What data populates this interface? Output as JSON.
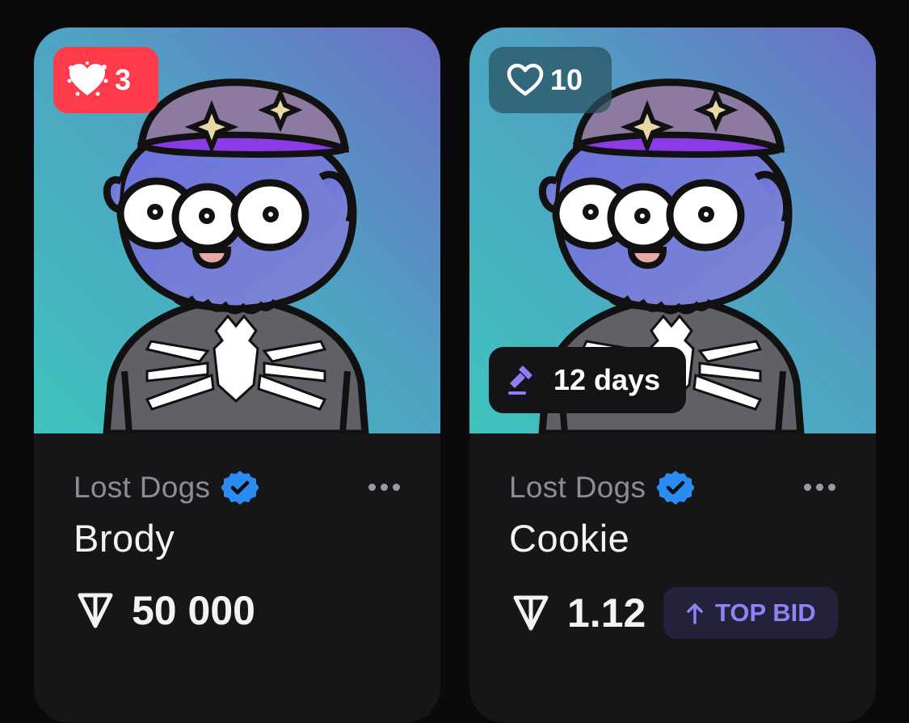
{
  "cards": [
    {
      "likes": "3",
      "liked": true,
      "collection": "Lost Dogs",
      "name": "Brody",
      "price": "50 000",
      "currency_icon": "ton-icon"
    },
    {
      "likes": "10",
      "liked": false,
      "auction_time": "12 days",
      "collection": "Lost Dogs",
      "name": "Cookie",
      "price": "1.12",
      "currency_icon": "ton-icon",
      "bid_tag": "TOP BID"
    }
  ],
  "colors": {
    "background": "#0a0a0c",
    "card": "#161618",
    "like_active": "#fe3b4a",
    "verified": "#2a8cf0",
    "top_bid_text": "#8f82f5",
    "top_bid_bg": "#24213a"
  }
}
